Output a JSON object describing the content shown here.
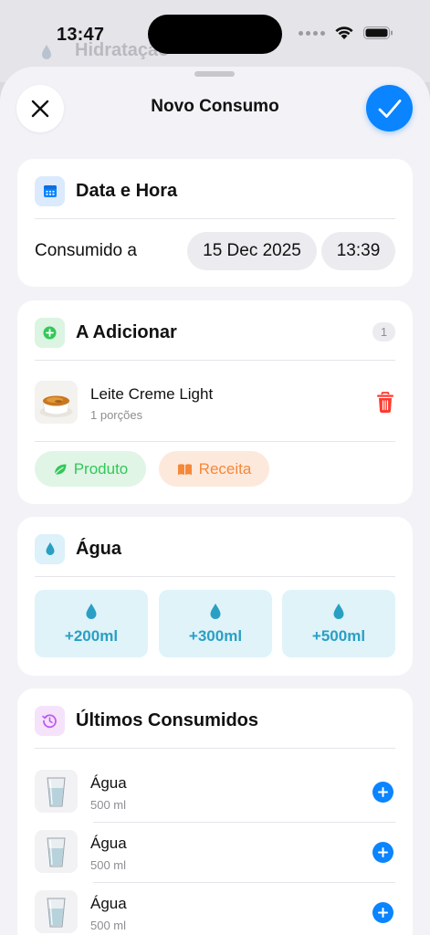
{
  "status": {
    "time": "13:47"
  },
  "background": {
    "title": "Hidratação"
  },
  "sheet": {
    "title": "Novo Consumo"
  },
  "date_card": {
    "title": "Data e Hora",
    "label": "Consumido a",
    "date": "15 Dec 2025",
    "time": "13:39"
  },
  "add_card": {
    "title": "A Adicionar",
    "count": "1",
    "items": [
      {
        "name": "Leite Creme Light",
        "portion": "1 porções"
      }
    ],
    "product_label": "Produto",
    "recipe_label": "Receita"
  },
  "water_card": {
    "title": "Água",
    "buttons": [
      "+200ml",
      "+300ml",
      "+500ml"
    ]
  },
  "recent_card": {
    "title": "Últimos Consumidos",
    "items": [
      {
        "name": "Água",
        "amount": "500 ml"
      },
      {
        "name": "Água",
        "amount": "500 ml"
      },
      {
        "name": "Água",
        "amount": "500 ml"
      }
    ]
  },
  "colors": {
    "accent": "#0a84ff",
    "green": "#34c759",
    "orange": "#f5883a",
    "water": "#2a9fc4",
    "purple": "#bf5af2",
    "danger": "#ff3b30"
  }
}
